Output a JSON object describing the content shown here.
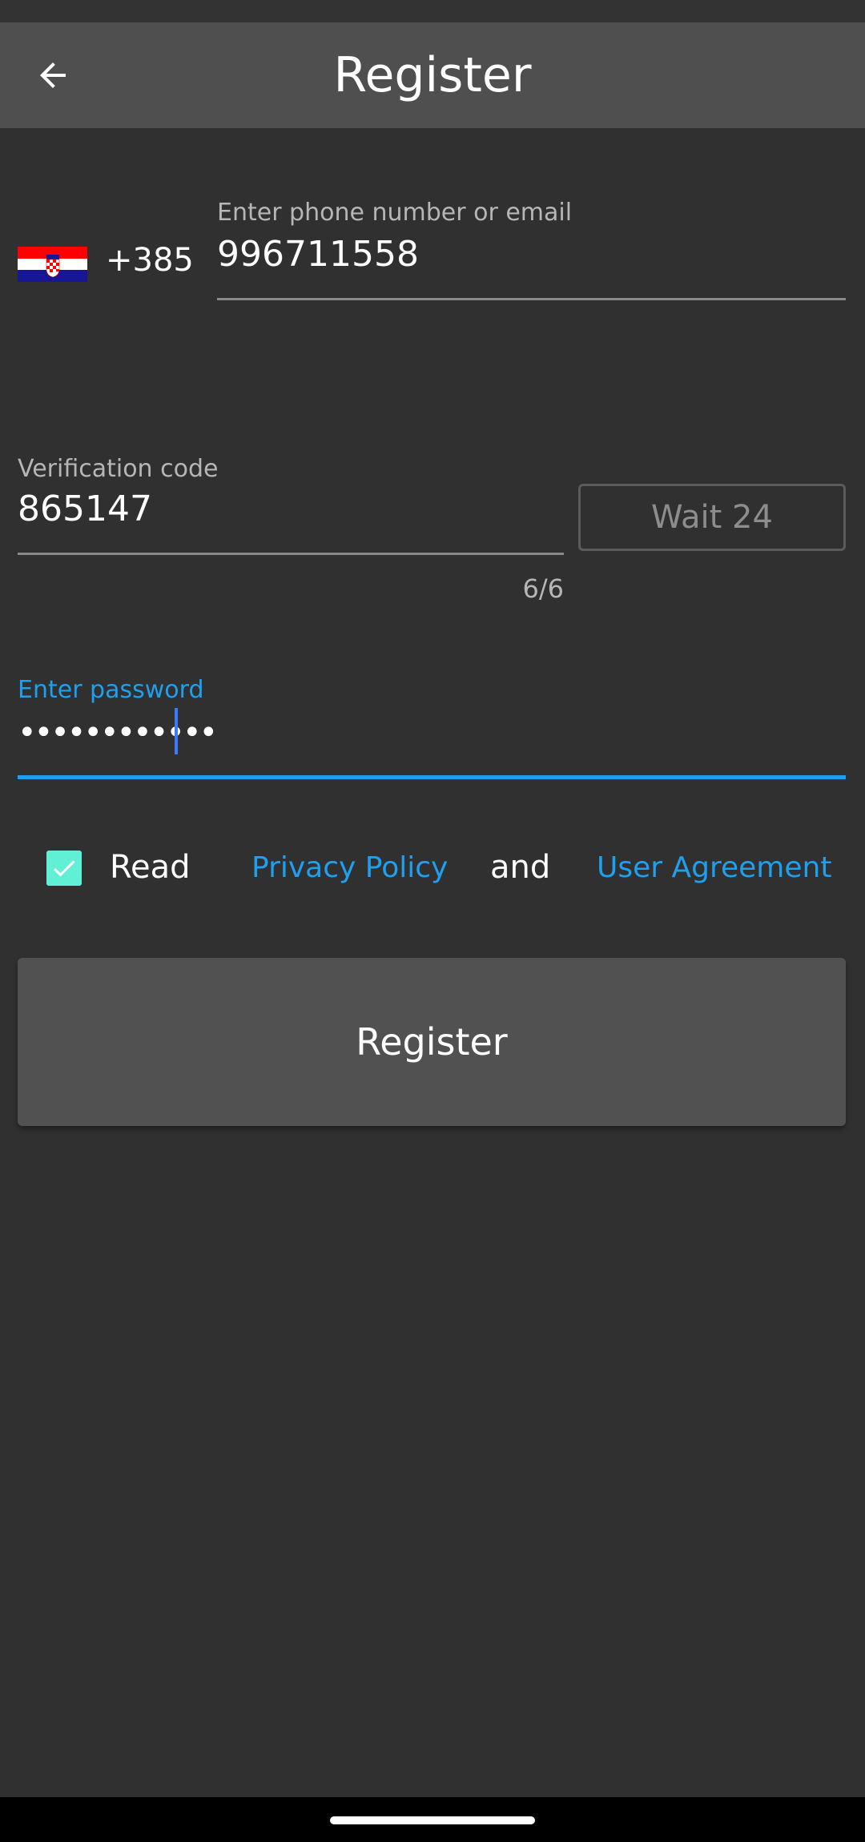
{
  "app_bar": {
    "title": "Register",
    "back_icon": "arrow-left-icon"
  },
  "phone": {
    "flag": "croatia-flag-icon",
    "country_code": "+385",
    "label": "Enter phone number or email",
    "value": "996711558"
  },
  "verification": {
    "label": "Verification code",
    "value": "865147",
    "counter": "6/6",
    "wait_button": "Wait 24"
  },
  "password": {
    "label": "Enter password",
    "value_masked": "••••••••••••"
  },
  "agreement": {
    "checked": true,
    "read_text": "Read",
    "privacy_link": "Privacy Policy",
    "and_text": "and",
    "agreement_link": "User Agreement"
  },
  "register_button": {
    "label": "Register"
  },
  "colors": {
    "background": "#303030",
    "app_bar": "#4f4f4f",
    "accent": "#1ea0ee",
    "checkbox": "#5ff0d6",
    "button": "#515151"
  }
}
